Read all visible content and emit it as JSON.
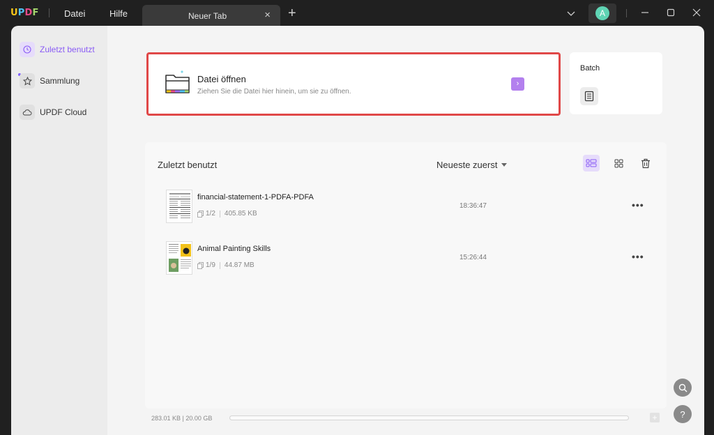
{
  "app": {
    "logo": "UPDF"
  },
  "menu": {
    "file": "Datei",
    "help": "Hilfe"
  },
  "tab": {
    "title": "Neuer Tab",
    "close": "×",
    "add": "+"
  },
  "user": {
    "avatar_letter": "A"
  },
  "sidebar": {
    "items": [
      {
        "label": "Zuletzt benutzt",
        "icon": "clock-icon",
        "active": true
      },
      {
        "label": "Sammlung",
        "icon": "star-icon",
        "active": false
      },
      {
        "label": "UPDF Cloud",
        "icon": "cloud-icon",
        "active": false
      }
    ]
  },
  "open_file": {
    "title": "Datei öffnen",
    "subtitle": "Ziehen Sie die Datei hier hinein, um sie zu öffnen.",
    "arrow": "›"
  },
  "batch": {
    "title": "Batch"
  },
  "recent": {
    "title": "Zuletzt benutzt",
    "sort_label": "Neueste zuerst",
    "files": [
      {
        "name": "financial-statement-1-PDFA-PDFA",
        "pages": "1/2",
        "size": "405.85 KB",
        "time": "18:36:47",
        "more": "•••"
      },
      {
        "name": "Animal Painting Skills",
        "pages": "1/9",
        "size": "44.87 MB",
        "time": "15:26:44",
        "more": "•••"
      }
    ]
  },
  "storage": {
    "text": "283.01 KB | 20.00 GB",
    "used_fraction": 0.0
  },
  "floating": {
    "search": "search-icon",
    "help": "?"
  },
  "colors": {
    "accent": "#8a5cf5",
    "highlight_border": "#e04848",
    "arrow_bg": "#b380ee"
  }
}
